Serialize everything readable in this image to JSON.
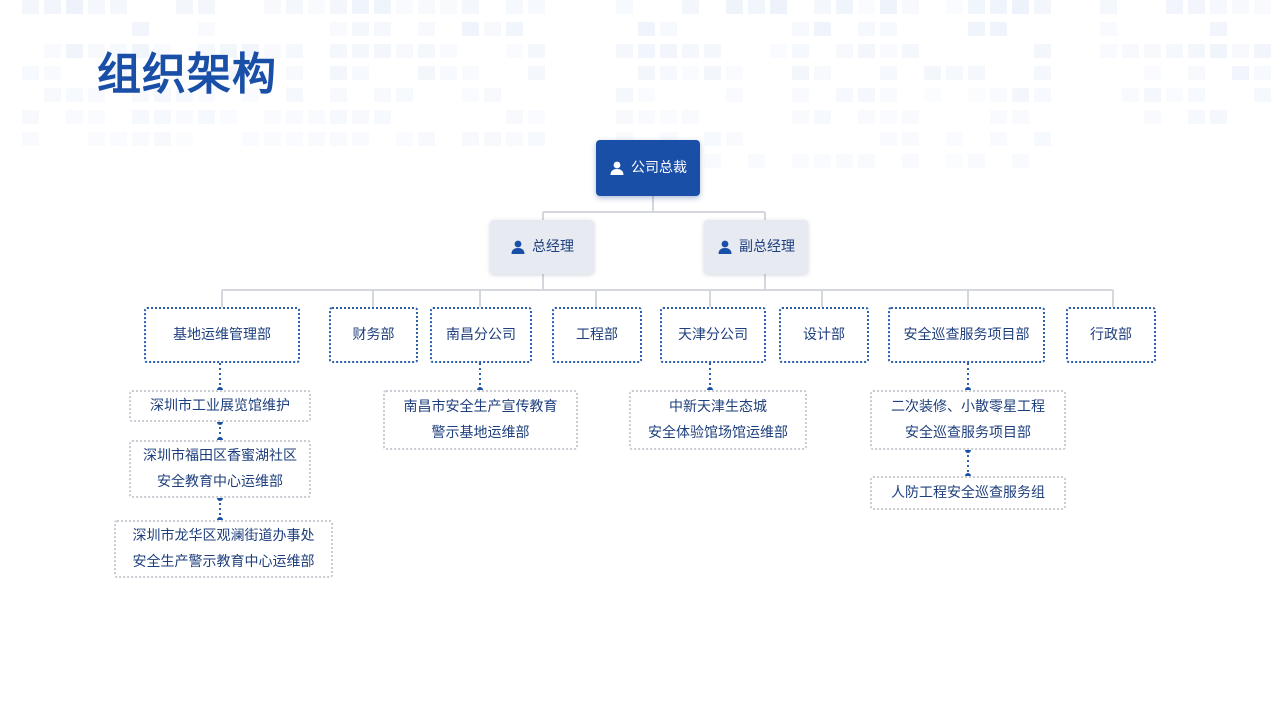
{
  "page": {
    "title": "组织架构"
  },
  "colors": {
    "primary": "#1a4fa8",
    "manager_bg": "#e7eaf1",
    "department_border": "#2c5fae",
    "sub_unit_border": "#c9ccd2",
    "connector": "#d4d7de"
  },
  "org": {
    "ceo": {
      "label": "公司总裁",
      "icon": "person-icon"
    },
    "general_manager": {
      "label": "总经理",
      "icon": "person-icon"
    },
    "deputy_general_manager": {
      "label": "副总经理",
      "icon": "person-icon"
    },
    "departments": [
      {
        "label": "基地运维管理部"
      },
      {
        "label": "财务部"
      },
      {
        "label": "南昌分公司"
      },
      {
        "label": "工程部"
      },
      {
        "label": "天津分公司"
      },
      {
        "label": "设计部"
      },
      {
        "label": "安全巡查服务项目部"
      },
      {
        "label": "行政部"
      }
    ],
    "sub_units": {
      "base_ops": [
        {
          "lines": [
            "深圳市工业展览馆维护"
          ]
        },
        {
          "lines": [
            "深圳市福田区香蜜湖社区",
            "安全教育中心运维部"
          ]
        },
        {
          "lines": [
            "深圳市龙华区观澜街道办事处",
            "安全生产警示教育中心运维部"
          ]
        }
      ],
      "nanchang": [
        {
          "lines": [
            "南昌市安全生产宣传教育",
            "警示基地运维部"
          ]
        }
      ],
      "tianjin": [
        {
          "lines": [
            "中新天津生态城",
            "安全体验馆场馆运维部"
          ]
        }
      ],
      "safety_patrol": [
        {
          "lines": [
            "二次装修、小散零星工程",
            "安全巡查服务项目部"
          ]
        },
        {
          "lines": [
            "人防工程安全巡查服务组"
          ]
        }
      ]
    }
  }
}
